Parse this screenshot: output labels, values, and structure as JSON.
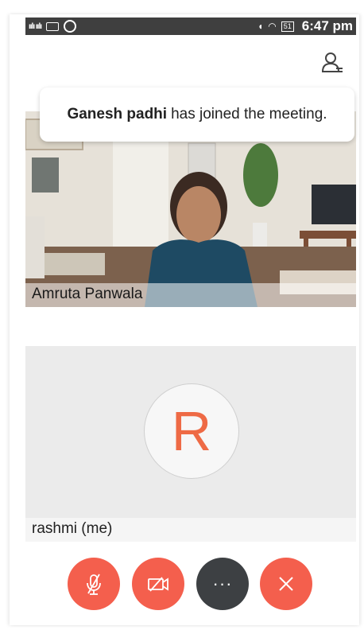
{
  "status_bar": {
    "signal_left": "ıılı ıılı",
    "time": "6:47 pm",
    "battery": "51"
  },
  "toast": {
    "name": "Ganesh padhi",
    "message": "has joined the meeting."
  },
  "video": {
    "participant_name": "Amruta Panwala"
  },
  "self": {
    "avatar_letter": "R",
    "name": "rashmi (me)"
  },
  "controls": {
    "more_label": "···"
  },
  "colors": {
    "red": "#f45f4d",
    "dark": "#3d4043",
    "avatar_letter": "#ee6a45"
  }
}
